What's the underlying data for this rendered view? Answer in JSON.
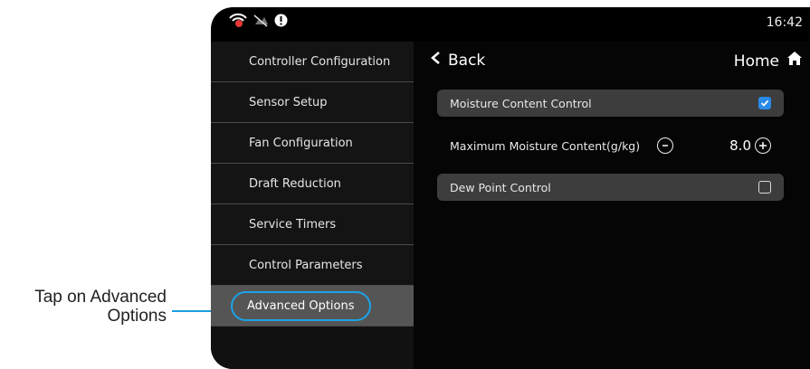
{
  "annotation": {
    "text_line1": "Tap on Advanced",
    "text_line2": "Options"
  },
  "status_bar": {
    "time": "16:42",
    "icons": [
      "wifi-alert-icon",
      "cloud-off-icon",
      "info-icon"
    ]
  },
  "sidebar": {
    "items": [
      {
        "label": "Controller Configuration"
      },
      {
        "label": "Sensor Setup"
      },
      {
        "label": "Fan Configuration"
      },
      {
        "label": "Draft Reduction"
      },
      {
        "label": "Service Timers"
      },
      {
        "label": "Control Parameters"
      },
      {
        "label": "Advanced Options",
        "active": true
      }
    ]
  },
  "header": {
    "back_label": "Back",
    "home_label": "Home"
  },
  "settings": {
    "moisture_control": {
      "label": "Moisture Content Control",
      "checked": true
    },
    "max_moisture": {
      "label": "Maximum Moisture Content(g/kg)",
      "value": "8.0"
    },
    "dew_point": {
      "label": "Dew Point Control",
      "checked": false
    }
  },
  "colors": {
    "accent": "#1ba3e8",
    "checkbox": "#2a8ae8"
  }
}
